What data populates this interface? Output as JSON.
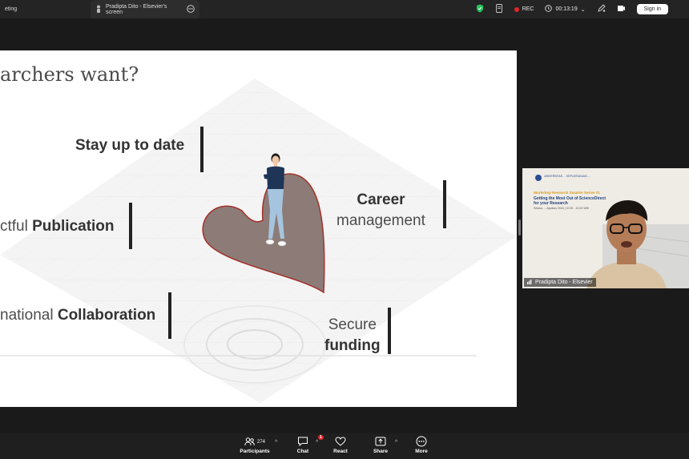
{
  "topbar": {
    "tab1_label": "eting",
    "tab2_label": "Pradipta Dito - Elsevier's screen",
    "rec_label": "REC",
    "timer": "00:13:19",
    "signin_label": "Sign in"
  },
  "slide": {
    "title": "archers want?",
    "items": {
      "stay": "Stay up to date",
      "career_bold": "Career",
      "career_rest": "management",
      "pub_prefix": "ctful ",
      "pub_bold": "Publication",
      "collab_prefix": "national ",
      "collab_bold": "Collaboration",
      "secure_rest": "Secure",
      "secure_bold": "funding"
    },
    "heart_color": "#8c7b76"
  },
  "video": {
    "name": "Pradipta Dito - Elsevier",
    "org_line": "UNIVERSITAS ... KEPUSTAKAAN ...",
    "series": "Workshop Research Smarter Series #1",
    "headline1": "Getting the Most Out of ScienceDirect",
    "headline2": "for your Research",
    "date": "Selasa, ... Agustus 2024 | 10:00 - 12:00 WIB"
  },
  "bottombar": {
    "participants_count": "274",
    "participants_label": "Participants",
    "chat_label": "Chat",
    "chat_badge": "1",
    "react_label": "React",
    "share_label": "Share",
    "more_label": "More"
  },
  "colors": {
    "accent": "#0e72ed",
    "rec": "#e02828",
    "shield": "#22c55e"
  }
}
